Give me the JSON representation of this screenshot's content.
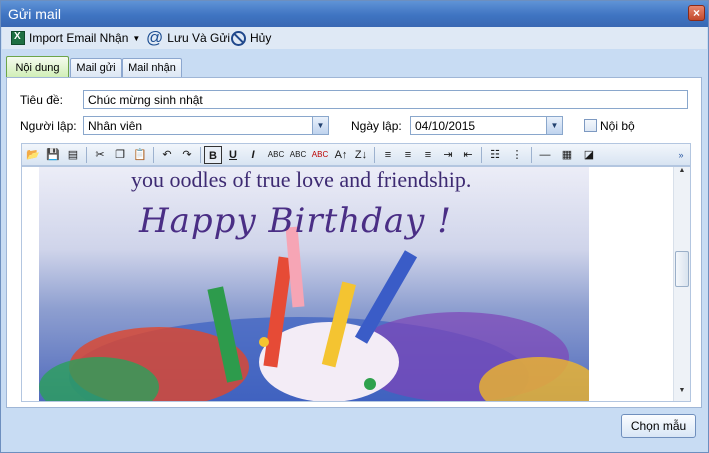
{
  "window": {
    "title": "Gửi mail",
    "close_glyph": "×"
  },
  "menubar": {
    "import_label": "Import Email Nhận",
    "save_send_label": "Lưu Và Gửi",
    "cancel_label": "Hủy"
  },
  "tabs": [
    {
      "label": "Nội dung",
      "active": true
    },
    {
      "label": "Mail gửi",
      "active": false
    },
    {
      "label": "Mail nhận",
      "active": false
    }
  ],
  "form": {
    "subject_label": "Tiêu đề:",
    "subject_value": "Chúc mừng sinh nhật",
    "creator_label": "Người lập:",
    "creator_value": "Nhân viên",
    "date_label": "Ngày lập:",
    "date_value": "04/10/2015",
    "internal_label": "Nội bộ",
    "internal_checked": false
  },
  "toolbar": {
    "icons": [
      "open-folder-icon",
      "save-icon",
      "properties-icon",
      "cut-icon",
      "copy-icon",
      "paste-icon",
      "undo-icon",
      "redo-icon",
      "bold-icon",
      "underline-icon",
      "italic-icon",
      "strikethrough-icon",
      "small-caps-icon",
      "text-color-icon",
      "sort-asc-icon",
      "sort-desc-icon",
      "align-left-icon",
      "align-center-icon",
      "align-right-icon",
      "indent-icon",
      "outdent-icon",
      "bulleted-list-icon",
      "numbered-list-icon",
      "horizontal-rule-icon",
      "table-icon",
      "highlight-icon",
      "more-icon"
    ]
  },
  "editor": {
    "line1": "you oodles of true love and friendship.",
    "line2": "Happy Birthday !"
  },
  "footer": {
    "template_button": "Chọn mẫu"
  }
}
